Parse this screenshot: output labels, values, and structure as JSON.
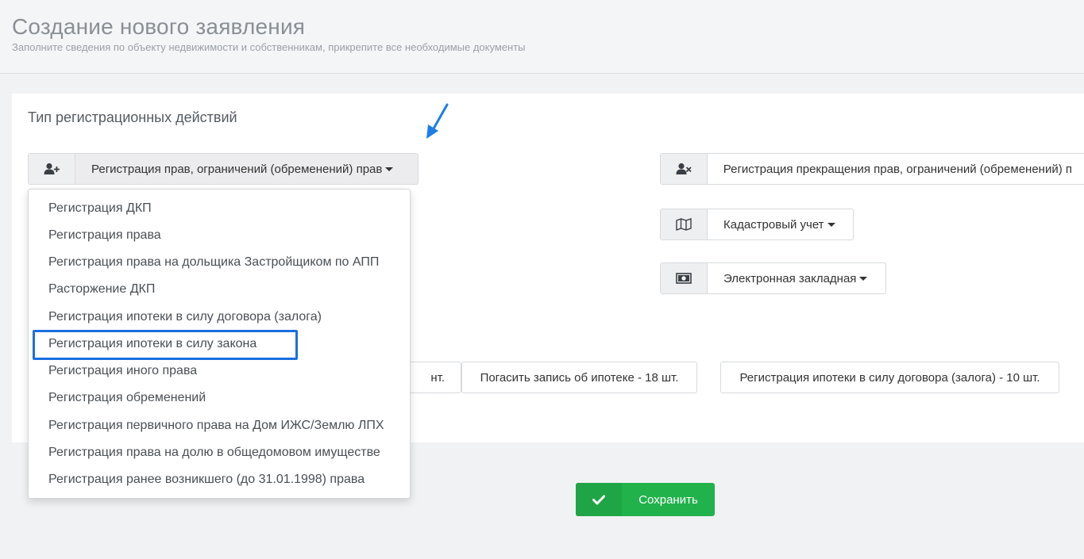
{
  "header": {
    "title": "Создание нового заявления",
    "subtitle": "Заполните сведения по объекту недвижимости и собственникам, прикрепите все необходимые документы"
  },
  "section": {
    "title": "Тип регистрационных действий"
  },
  "actions": {
    "register_rights": {
      "label": "Регистрация прав, ограничений (обременений) прав",
      "icon": "user-plus-icon"
    },
    "register_termination": {
      "label": "Регистрация прекращения прав, ограничений (обременений) п",
      "icon": "user-times-icon"
    },
    "cadastral": {
      "label": "Кадастровый учет",
      "icon": "map-icon"
    },
    "mortgage_doc": {
      "label": "Электронная закладная",
      "icon": "money-icon"
    }
  },
  "quick_buttons": {
    "partial": "нт.",
    "repay": "Погасить запись об ипотеке - 18 шт.",
    "mortgage_contract": "Регистрация ипотеки в силу договора (залога) - 10 шт."
  },
  "dropdown": {
    "items": [
      "Регистрация ДКП",
      "Регистрация права",
      "Регистрация права на дольщика Застройщиком по АПП",
      "Расторжение ДКП",
      "Регистрация ипотеки в силу договора (залога)",
      "Регистрация ипотеки в силу закона",
      "Регистрация иного права",
      "Регистрация обременений",
      "Регистрация первичного права на Дом ИЖС/Землю ЛПХ",
      "Регистрация права на долю в общедомовом имуществе",
      "Регистрация ранее возникшего (до 31.01.1998) права"
    ],
    "highlighted_index": 5
  },
  "save_button": {
    "label": "Сохранить",
    "icon": "check-icon",
    "color": "#22b24c"
  },
  "colors": {
    "highlight": "#1a6fe0",
    "arrow": "#1a7fe8"
  }
}
